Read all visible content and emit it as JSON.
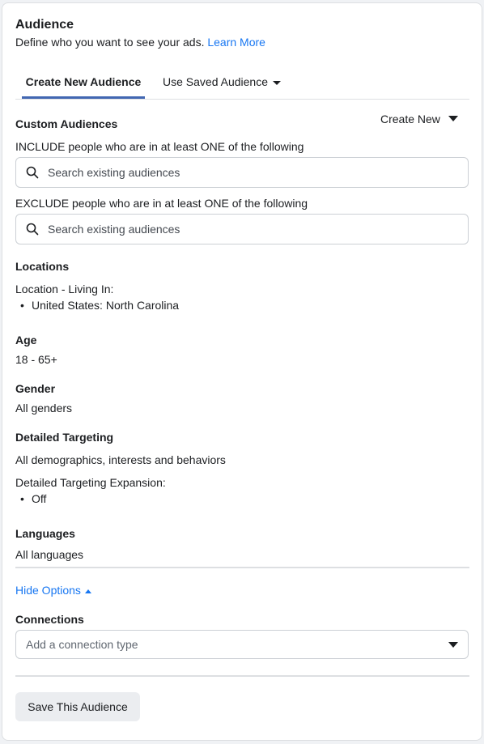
{
  "header": {
    "title": "Audience",
    "description": "Define who you want to see your ads.",
    "learn_more": "Learn More"
  },
  "tabs": [
    {
      "label": "Create New Audience",
      "active": true
    },
    {
      "label": "Use Saved Audience",
      "active": false
    }
  ],
  "custom_audiences": {
    "heading": "Custom Audiences",
    "create_new": "Create New",
    "include_label": "INCLUDE people who are in at least ONE of the following",
    "include_placeholder": "Search existing audiences",
    "exclude_label": "EXCLUDE people who are in at least ONE of the following",
    "exclude_placeholder": "Search existing audiences"
  },
  "locations": {
    "heading": "Locations",
    "type": "Location - Living In:",
    "items": [
      "United States: North Carolina"
    ]
  },
  "age": {
    "heading": "Age",
    "value": "18 - 65+"
  },
  "gender": {
    "heading": "Gender",
    "value": "All genders"
  },
  "detailed_targeting": {
    "heading": "Detailed Targeting",
    "value": "All demographics, interests and behaviors",
    "expansion_label": "Detailed Targeting Expansion:",
    "expansion_items": [
      "Off"
    ]
  },
  "languages": {
    "heading": "Languages",
    "value": "All languages"
  },
  "options": {
    "toggle_label": "Hide Options"
  },
  "connections": {
    "heading": "Connections",
    "placeholder": "Add a connection type"
  },
  "footer": {
    "save_label": "Save This Audience"
  },
  "colors": {
    "accent": "#4267b2",
    "link": "#1877f2"
  }
}
